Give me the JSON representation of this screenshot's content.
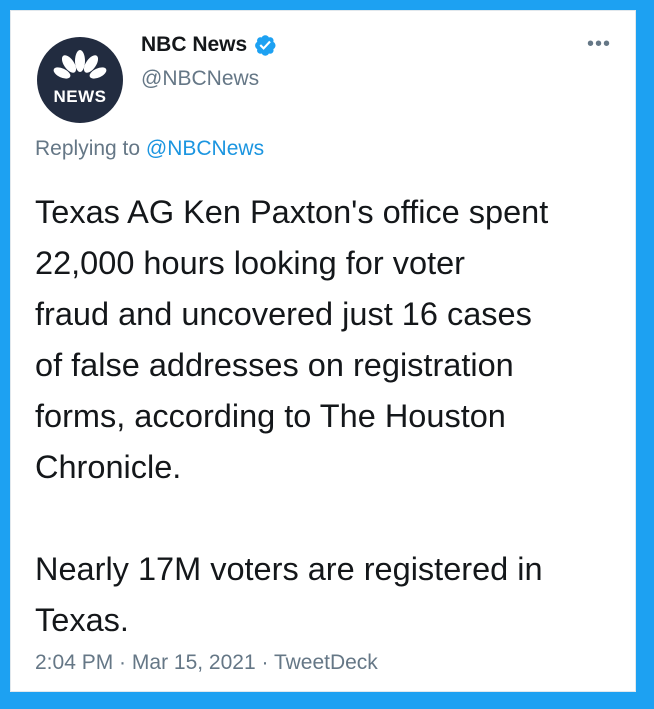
{
  "tweet": {
    "author": {
      "display_name": "NBC News",
      "handle": "@NBCNews",
      "verified": true,
      "avatar_label": "NEWS"
    },
    "more_menu_label": "•••",
    "reply_prefix": "Replying to ",
    "reply_mention": "@NBCNews",
    "text": "Texas AG Ken Paxton's office spent\n22,000 hours looking for voter\nfraud and uncovered just 16 cases\nof false addresses on registration\nforms, according to The Houston\nChronicle.\n\nNearly 17M voters are registered in\nTexas.",
    "time": "2:04 PM",
    "date": "Mar 15, 2021",
    "source": "TweetDeck",
    "separator": " · "
  },
  "colors": {
    "frame": "#1da1f2",
    "text": "#14171a",
    "secondary": "#657786",
    "link": "#1b95e0",
    "verified": "#1da1f2",
    "avatar_bg": "#222c40"
  },
  "icons": {
    "avatar": "nbc-peacock-logo",
    "verified": "verified-badge-icon",
    "more": "more-options-icon"
  }
}
